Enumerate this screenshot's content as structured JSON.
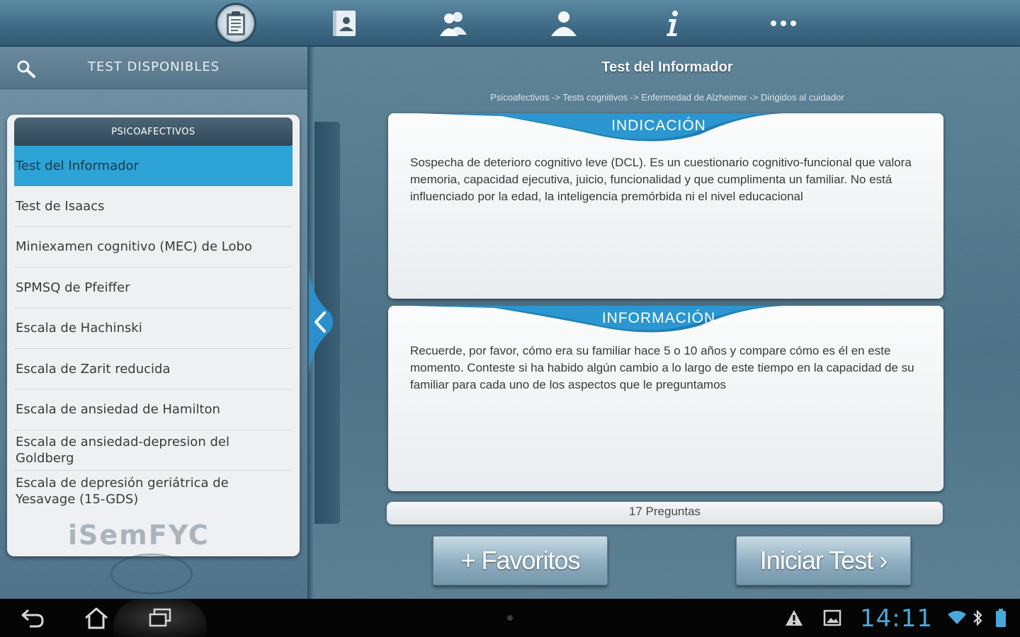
{
  "topbar": {
    "tabs": [
      {
        "icon": "clipboard-icon",
        "active": true
      },
      {
        "icon": "contact-card-icon",
        "active": false
      },
      {
        "icon": "people-icon",
        "active": false
      },
      {
        "icon": "person-icon",
        "active": false
      },
      {
        "icon": "info-icon",
        "active": false
      },
      {
        "icon": "more-icon",
        "active": false
      }
    ]
  },
  "left": {
    "title": "TEST  DISPONIBLES",
    "section": "PSICOAFECTIVOS",
    "items": [
      "Test del Informador",
      "Test de Isaacs",
      "Miniexamen cognitivo (MEC) de Lobo",
      "SPMSQ de Pfeiffer",
      "Escala de Hachinski",
      "Escala de Zarit reducida",
      "Escala de ansiedad de Hamilton",
      "Escala de ansiedad-depresion del Goldberg",
      "Escala de depresión geriátrica de Yesavage (15-GDS)"
    ],
    "selected_index": 0,
    "watermark": "iSemFYC"
  },
  "right": {
    "title": "Test del Informador",
    "breadcrumb": "Psicoafectivos -> Tests cognitivos -> Enfermedad de Alzheimer -> Dirigidos al cuidador",
    "indicacion": {
      "label": "INDICACIÓN",
      "text": "Sospecha de deterioro cognitivo leve (DCL). Es un cuestionario cognitivo-funcional que valora memoria, capacidad ejecutiva, juicio, funcionalidad y que cumplimenta un familiar. No está influenciado por la edad, la inteligencia premórbida ni el nivel educacional"
    },
    "informacion": {
      "label": "INFORMACIÓN",
      "text": "Recuerde, por favor, cómo era su familiar hace 5 o 10 años y compare cómo es él en este momento. Conteste si ha habido algún cambio a lo largo de este tiempo en la capacidad de su familiar para cada uno de los aspectos que le preguntamos"
    },
    "question_count": "17 Preguntas",
    "favorites_label": "+ Favoritos",
    "start_label": "Iniciar Test ›"
  },
  "system_bar": {
    "clock": "14:11",
    "accent": "#4aa7d9"
  },
  "colors": {
    "selected": "#2ea3d6",
    "badge": "#1f7fb5",
    "header_dark": "#2f4757"
  }
}
